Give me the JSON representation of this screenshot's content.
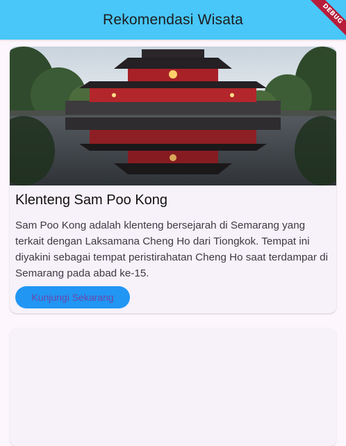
{
  "appbar": {
    "title": "Rekomendasi Wisata"
  },
  "debug_banner": "DEBUG",
  "cards": [
    {
      "title": "Klenteng Sam Poo Kong",
      "description": "Sam Poo Kong adalah klenteng bersejarah di Semarang yang terkait dengan Laksamana Cheng Ho dari Tiongkok. Tempat ini diyakini sebagai tempat peristirahatan Cheng Ho saat terdampar di Semarang pada abad ke-15.",
      "button_label": "Kunjungi Sekarang"
    }
  ],
  "colors": {
    "appbar": "#48c7f8",
    "button": "#2196f3",
    "button_text": "#6a48a8",
    "background": "#fdf7fd",
    "card": "#f7f1fa"
  }
}
